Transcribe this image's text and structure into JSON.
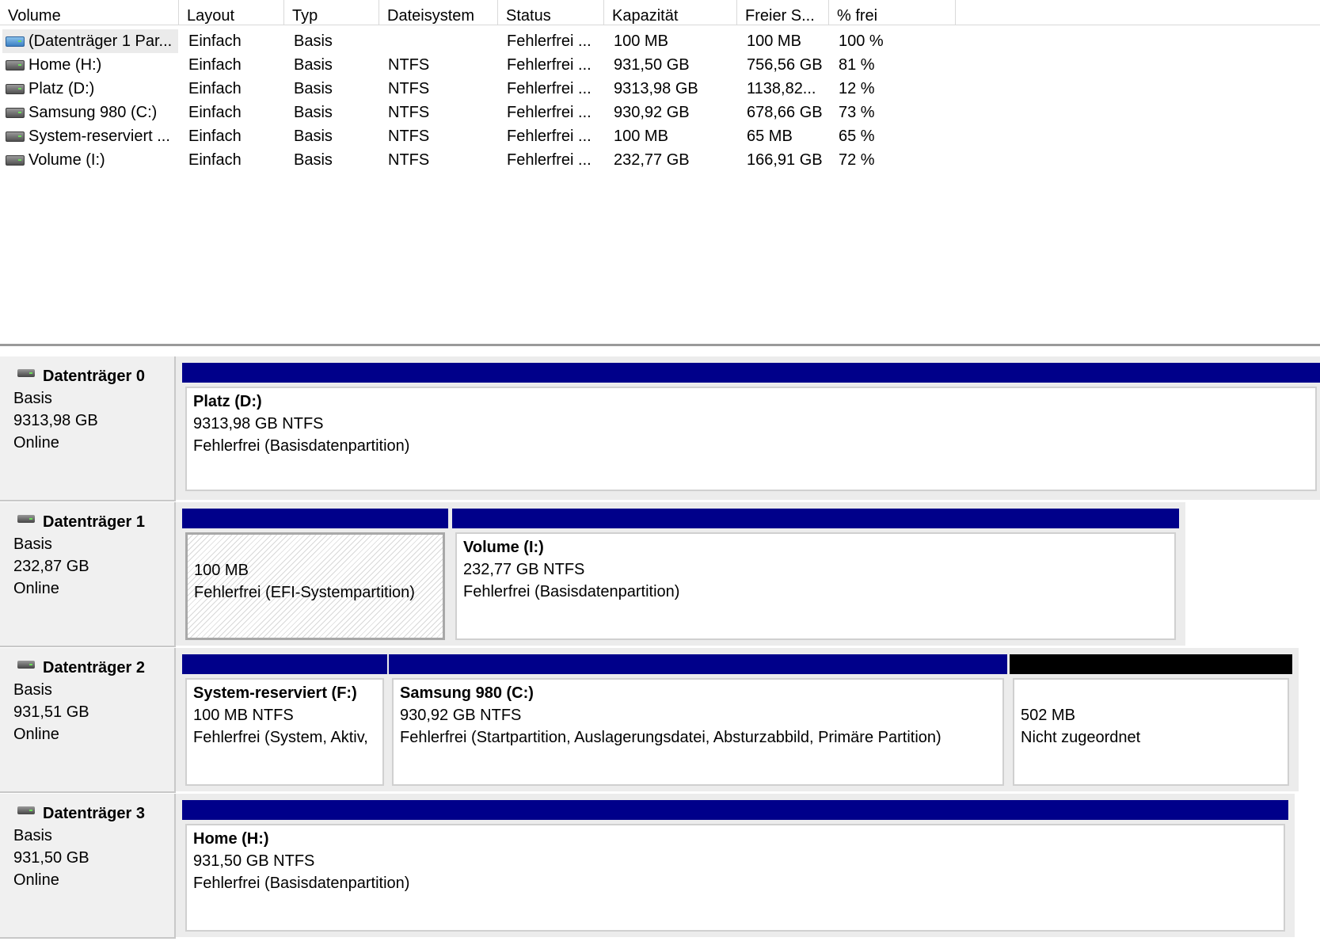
{
  "columns": [
    "Volume",
    "Layout",
    "Typ",
    "Dateisystem",
    "Status",
    "Kapazität",
    "Freier S...",
    "% frei"
  ],
  "volumes": [
    {
      "name": "(Datenträger 1 Par...",
      "layout": "Einfach",
      "type": "Basis",
      "fs": "",
      "status": "Fehlerfrei ...",
      "capacity": "100 MB",
      "free": "100 MB",
      "pct": "100 %",
      "icon": "efi-volume-icon"
    },
    {
      "name": "Home (H:)",
      "layout": "Einfach",
      "type": "Basis",
      "fs": "NTFS",
      "status": "Fehlerfrei ...",
      "capacity": "931,50 GB",
      "free": "756,56 GB",
      "pct": "81 %",
      "icon": "volume-icon"
    },
    {
      "name": "Platz (D:)",
      "layout": "Einfach",
      "type": "Basis",
      "fs": "NTFS",
      "status": "Fehlerfrei ...",
      "capacity": "9313,98 GB",
      "free": "1138,82...",
      "pct": "12 %",
      "icon": "volume-icon"
    },
    {
      "name": "Samsung 980 (C:)",
      "layout": "Einfach",
      "type": "Basis",
      "fs": "NTFS",
      "status": "Fehlerfrei ...",
      "capacity": "930,92 GB",
      "free": "678,66 GB",
      "pct": "73 %",
      "icon": "volume-icon"
    },
    {
      "name": "System-reserviert ...",
      "layout": "Einfach",
      "type": "Basis",
      "fs": "NTFS",
      "status": "Fehlerfrei ...",
      "capacity": "100 MB",
      "free": "65 MB",
      "pct": "65 %",
      "icon": "volume-icon"
    },
    {
      "name": "Volume (I:)",
      "layout": "Einfach",
      "type": "Basis",
      "fs": "NTFS",
      "status": "Fehlerfrei ...",
      "capacity": "232,77 GB",
      "free": "166,91 GB",
      "pct": "72 %",
      "icon": "volume-icon"
    }
  ],
  "disks": [
    {
      "name": "Datenträger 0",
      "type": "Basis",
      "size": "9313,98 GB",
      "state": "Online",
      "icon": "disk-icon",
      "partitions": [
        {
          "title": "Platz  (D:)",
          "line1": "9313,98 GB NTFS",
          "line2": "Fehlerfrei (Basisdatenpartition)"
        }
      ]
    },
    {
      "name": "Datenträger 1",
      "type": "Basis",
      "size": "232,87 GB",
      "state": "Online",
      "icon": "disk-icon",
      "partitions": [
        {
          "title": "",
          "line1": "100 MB",
          "line2": "Fehlerfrei (EFI-Systempartition)"
        },
        {
          "title": "Volume  (I:)",
          "line1": "232,77 GB NTFS",
          "line2": "Fehlerfrei (Basisdatenpartition)"
        }
      ]
    },
    {
      "name": "Datenträger 2",
      "type": "Basis",
      "size": "931,51 GB",
      "state": "Online",
      "icon": "disk-icon",
      "partitions": [
        {
          "title": "System-reserviert  (F:)",
          "line1": "100 MB NTFS",
          "line2": "Fehlerfrei (System, Aktiv,"
        },
        {
          "title": "Samsung 980  (C:)",
          "line1": "930,92 GB NTFS",
          "line2": "Fehlerfrei (Startpartition, Auslagerungsdatei, Absturzabbild, Primäre Partition)"
        },
        {
          "title": "",
          "line1": "502 MB",
          "line2": "Nicht zugeordnet"
        }
      ]
    },
    {
      "name": "Datenträger 3",
      "type": "Basis",
      "size": "931,50 GB",
      "state": "Online",
      "icon": "disk-icon",
      "partitions": [
        {
          "title": "Home  (H:)",
          "line1": "931,50 GB NTFS",
          "line2": "Fehlerfrei (Basisdatenpartition)"
        }
      ]
    }
  ],
  "colors": {
    "primary_partition": "#00008a",
    "unallocated": "#000000",
    "selection": "#ebebeb"
  }
}
